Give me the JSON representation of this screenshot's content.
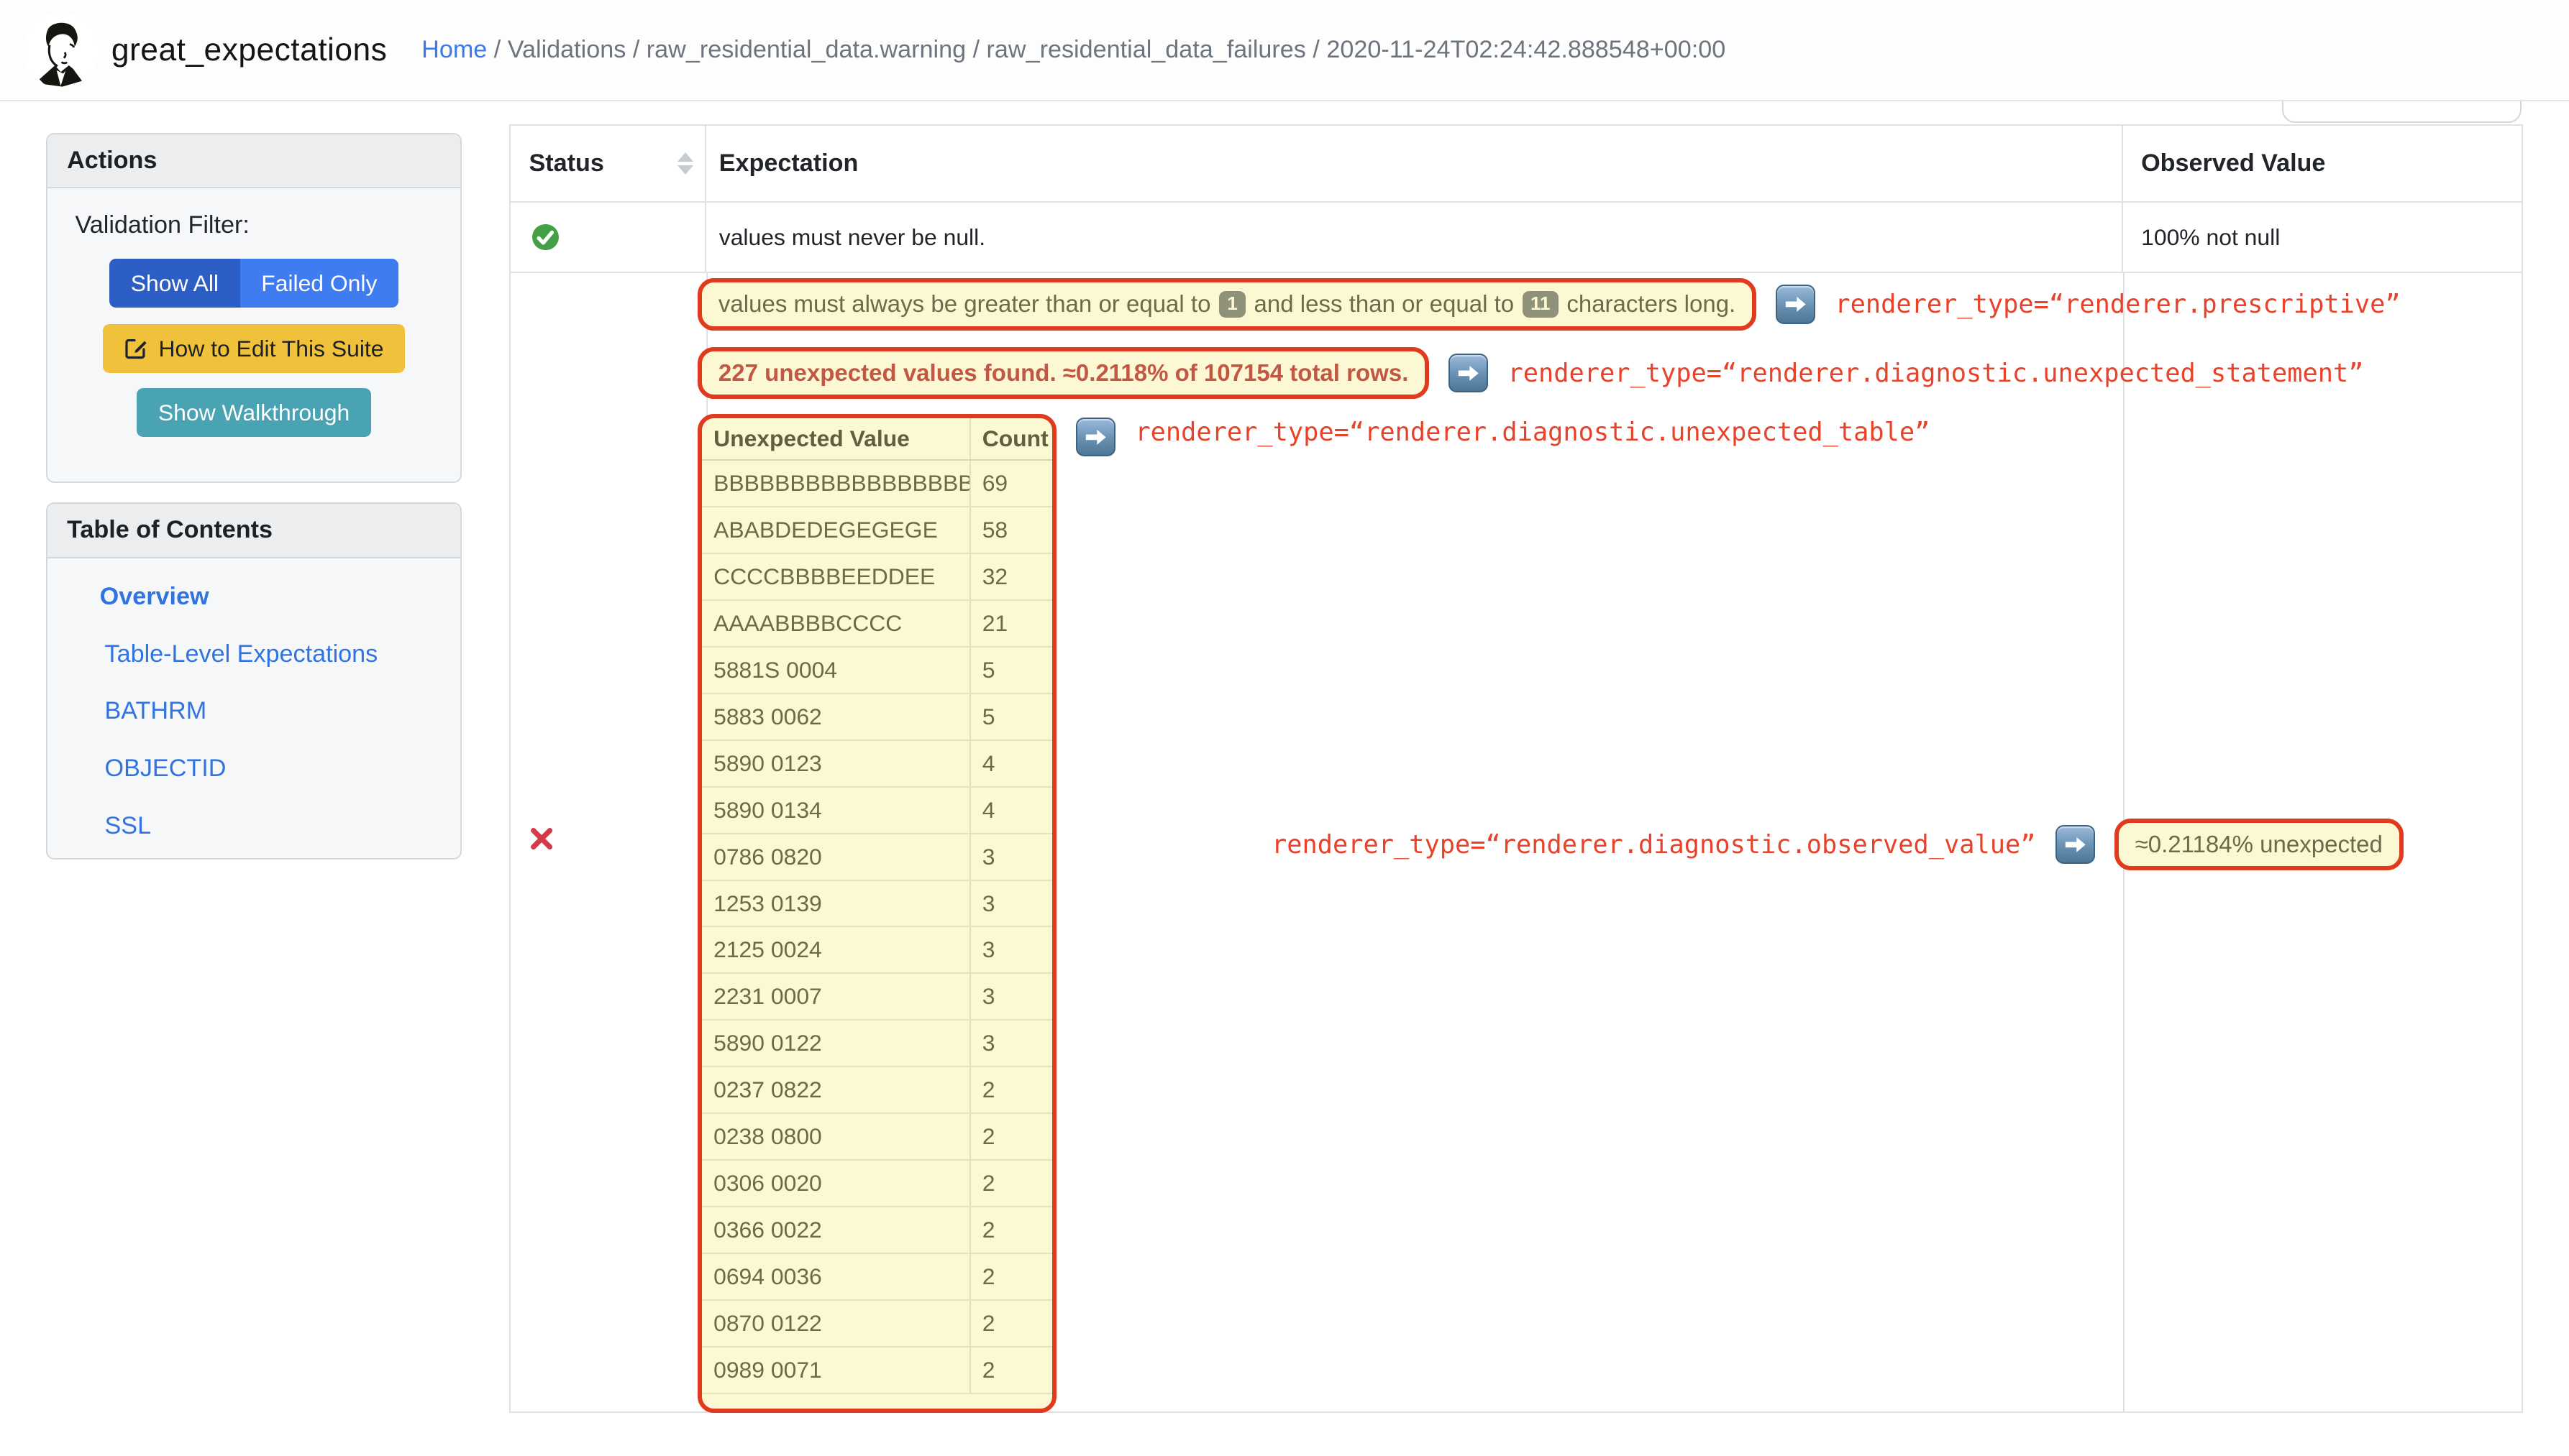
{
  "header": {
    "brand": "great_expectations",
    "breadcrumb_home": "Home",
    "breadcrumb_rest": " / Validations / raw_residential_data.warning / raw_residential_data_failures / 2020-11-24T02:24:42.888548+00:00"
  },
  "sidebar": {
    "actions": {
      "title": "Actions",
      "filter_label": "Validation Filter:",
      "show_all": "Show All",
      "failed_only": "Failed Only",
      "edit_suite": "How to Edit This Suite",
      "walkthrough": "Show Walkthrough"
    },
    "toc": {
      "title": "Table of Contents",
      "items": [
        {
          "label": "Overview",
          "active": true
        },
        {
          "label": "Table-Level Expectations"
        },
        {
          "label": "BATHRM"
        },
        {
          "label": "OBJECTID"
        },
        {
          "label": "SSL"
        }
      ]
    }
  },
  "vtable": {
    "columns": {
      "status": "Status",
      "expectation": "Expectation",
      "observed": "Observed Value"
    },
    "row1": {
      "status": "success",
      "expectation": "values must never be null.",
      "observed": "100% not null"
    }
  },
  "failed": {
    "status": "failed",
    "prescriptive": {
      "part1": "values must always be greater than or equal to",
      "badge_min": "1",
      "part2": "and less than or equal to",
      "badge_max": "11",
      "part3": "characters long."
    },
    "statement": "227 unexpected values found. ≈0.2118% of 107154 total rows.",
    "observed": "≈0.21184% unexpected",
    "renderers": {
      "prescriptive": "renderer_type=“renderer.prescriptive”",
      "statement": "renderer_type=“renderer.diagnostic.unexpected_statement”",
      "table": "renderer_type=“renderer.diagnostic.unexpected_table”",
      "observed": "renderer_type=“renderer.diagnostic.observed_value”"
    },
    "utable": {
      "col_value": "Unexpected Value",
      "col_count": "Count",
      "rows": [
        {
          "value": "BBBBBBBBBBBBBBBBB",
          "count": "69"
        },
        {
          "value": "ABABDEDEGEGEGE",
          "count": "58"
        },
        {
          "value": "CCCCBBBBEEDDEE",
          "count": "32"
        },
        {
          "value": "AAAABBBBCCCC",
          "count": "21"
        },
        {
          "value": "5881S 0004",
          "count": "5"
        },
        {
          "value": "5883 0062",
          "count": "5"
        },
        {
          "value": "5890 0123",
          "count": "4"
        },
        {
          "value": "5890 0134",
          "count": "4"
        },
        {
          "value": "0786 0820",
          "count": "3"
        },
        {
          "value": "1253 0139",
          "count": "3"
        },
        {
          "value": "2125 0024",
          "count": "3"
        },
        {
          "value": "2231 0007",
          "count": "3"
        },
        {
          "value": "5890 0122",
          "count": "3"
        },
        {
          "value": "0237 0822",
          "count": "2"
        },
        {
          "value": "0238 0800",
          "count": "2"
        },
        {
          "value": "0306 0020",
          "count": "2"
        },
        {
          "value": "0366 0022",
          "count": "2"
        },
        {
          "value": "0694 0036",
          "count": "2"
        },
        {
          "value": "0870 0122",
          "count": "2"
        },
        {
          "value": "0989 0071",
          "count": "2"
        }
      ]
    }
  },
  "colors": {
    "annotation_border": "#e03b1e",
    "annotation_bg": "#fcf8d3",
    "annotation_text": "#6b6b4a",
    "code_red": "#e8432a",
    "link_blue": "#3173e1",
    "success_green": "#43a047",
    "fail_red": "#d23b47",
    "btn_show_all": "#2d5ec6",
    "btn_failed_only": "#3f7cf0",
    "btn_edit": "#f0c23c",
    "btn_walkthrough": "#4aa3b3"
  },
  "icons": {
    "logo": "great-expectations-portrait",
    "edit": "pencil-square",
    "forward": "right-arrow",
    "sort": "sort-arrows",
    "success": "check-circle",
    "fail": "x-mark"
  }
}
